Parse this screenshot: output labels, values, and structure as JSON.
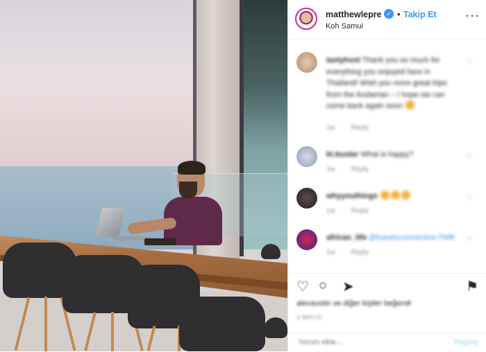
{
  "header": {
    "username": "matthewlepre",
    "verified_icon": "verified-badge-icon",
    "separator": "•",
    "follow_label": "Takip Et",
    "location": "Koh Samui",
    "more_label": "···"
  },
  "comments": [
    {
      "author": "tastyhost",
      "text": "Thank you so much for everything you enjoyed here in Thailand! Wish you more great trips from the Andaman – I hope we can come back again soon",
      "time": "1w",
      "reply_label": "Reply"
    },
    {
      "author": "kt.buster",
      "text": "What is happy?",
      "time": "1w",
      "reply_label": "Reply"
    },
    {
      "author": "whyyouthings",
      "text": "",
      "time": "1w",
      "reply_label": "Reply"
    },
    {
      "author": "african_life",
      "text": "@travelsconnectme FMB",
      "time": "1w",
      "reply_label": "Reply"
    }
  ],
  "actions": {
    "like_icon": "heart-icon",
    "comment_icon": "comment-icon",
    "share_icon": "share-icon",
    "save_icon": "bookmark-icon"
  },
  "likes_text": "alexaustin ve diğer kişiler beğendi",
  "date_text": "3 MAYIS",
  "add_comment": {
    "placeholder": "Yorum ekle...",
    "post_label": "Paylaş"
  },
  "colors": {
    "accent": "#3897f0",
    "text": "#262626",
    "muted": "#8e8e8e"
  }
}
